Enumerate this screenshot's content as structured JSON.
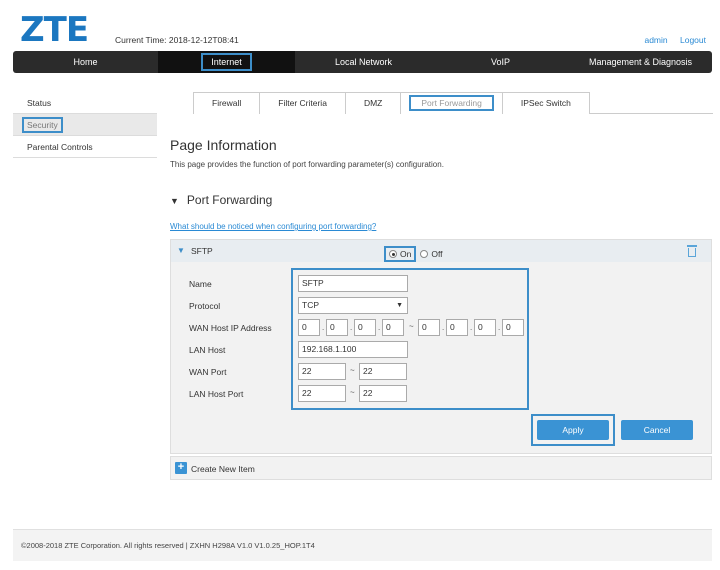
{
  "header": {
    "logo": "ZTE",
    "current_time": "Current Time: 2018-12-12T08:41",
    "links": [
      "admin",
      "Logout"
    ]
  },
  "nav": {
    "items": [
      "Home",
      "Internet",
      "Local Network",
      "VoIP",
      "Management & Diagnosis"
    ],
    "active": "Internet"
  },
  "sidebar": {
    "items": [
      "Status",
      "Security",
      "Parental Controls"
    ],
    "active": "Security"
  },
  "subtabs": {
    "items": [
      "Firewall",
      "Filter Criteria",
      "DMZ",
      "Port Forwarding",
      "IPSec Switch"
    ],
    "active": "Port Forwarding"
  },
  "page": {
    "title": "Page Information",
    "description": "This page provides the function of port forwarding parameter(s) configuration.",
    "section_title": "Port Forwarding",
    "notice_link": "What should be noticed when configuring port forwarding?"
  },
  "rule": {
    "name": "SFTP",
    "on_label": "On",
    "off_label": "Off",
    "state": "On",
    "labels": {
      "name": "Name",
      "protocol": "Protocol",
      "wan_ip": "WAN Host IP Address",
      "lan_host": "LAN Host",
      "wan_port": "WAN Port",
      "lan_port": "LAN Host Port"
    },
    "values": {
      "name": "SFTP",
      "protocol": "TCP",
      "wan_ip_start": [
        "0",
        "0",
        "0",
        "0"
      ],
      "wan_ip_end": [
        "0",
        "0",
        "0",
        "0"
      ],
      "lan_host": "192.168.1.100",
      "wan_port_start": "22",
      "wan_port_end": "22",
      "lan_port_start": "22",
      "lan_port_end": "22"
    },
    "dot": ".",
    "range_sep": "~",
    "apply": "Apply",
    "cancel": "Cancel"
  },
  "create_new": "Create New Item",
  "footer": "©2008-2018 ZTE Corporation. All rights reserved  |  ZXHN H298A V1.0 V1.0.25_HOP.1T4"
}
